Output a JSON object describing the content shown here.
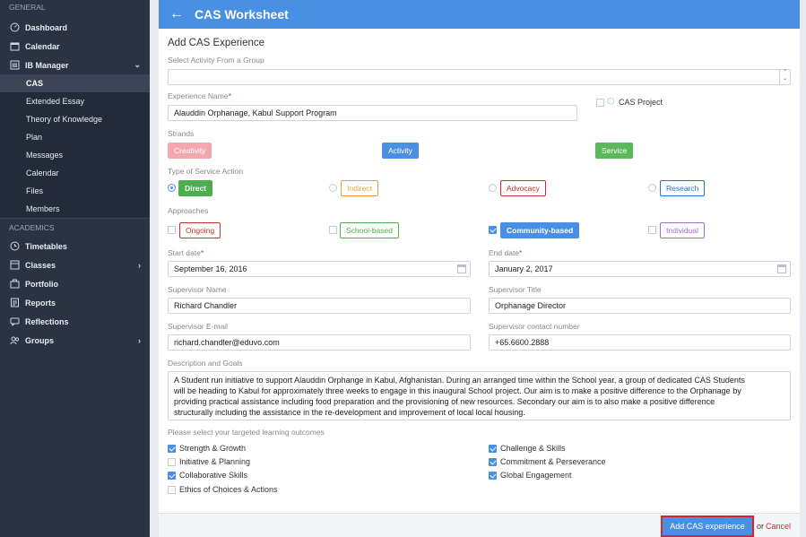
{
  "sidebar": {
    "general_label": "GENERAL",
    "academics_label": "ACADEMICS",
    "dashboard": "Dashboard",
    "calendar": "Calendar",
    "ib_manager": "IB Manager",
    "ib_items": [
      "CAS",
      "Extended Essay",
      "Theory of Knowledge",
      "Plan",
      "Messages",
      "Calendar",
      "Files",
      "Members"
    ],
    "timetables": "Timetables",
    "classes": "Classes",
    "portfolio": "Portfolio",
    "reports": "Reports",
    "reflections": "Reflections",
    "groups": "Groups"
  },
  "header": {
    "title": "CAS Worksheet"
  },
  "form": {
    "heading": "Add CAS Experience",
    "select_activity_label": "Select Activity From a Group",
    "select_activity_value": "",
    "experience_name_label": "Experience Name",
    "experience_name_value": "Alauddin Orphanage, Kabul Support Program",
    "cas_project_label": "CAS Project",
    "strands_label": "Strands",
    "strands": [
      "Creativity",
      "Activity",
      "Service"
    ],
    "service_type_label": "Type of Service Action",
    "service_types": [
      "Direct",
      "Indirect",
      "Advocacy",
      "Research"
    ],
    "approaches_label": "Approaches",
    "approaches": [
      "Ongoing",
      "School-based",
      "Community-based",
      "Individual"
    ],
    "start_date_label": "Start date",
    "start_date_value": "September 16, 2016",
    "end_date_label": "End date",
    "end_date_value": "January 2, 2017",
    "supervisor_name_label": "Supervisor Name",
    "supervisor_name_value": "Richard Chandler",
    "supervisor_title_label": "Supervisor Title",
    "supervisor_title_value": "Orphanage Director",
    "supervisor_email_label": "Supervisor E-mail",
    "supervisor_email_value": "richard.chandler@eduvo.com",
    "supervisor_contact_label": "Supervisor contact number",
    "supervisor_contact_value": "+65.6600.2888",
    "description_label": "Description and Goals",
    "description_lines": [
      "A Student run initiative to support Alauddin Orphange in Kabul, Afghanistan. During an arranged time within the School year, a group of dedicated CAS Students",
      "will be heading to Kabul for approximately three weeks to engage in this inaugural School project. Our aim is to make a positive difference to the Orphanage by",
      "providing practical assistance including food preparation and the provisioning of new resources. Secondary our aim is to also make a positive difference",
      "structurally including the assistance in the re-development and improvement of local local housing."
    ],
    "outcomes_label": "Please select your targeted learning outcomes",
    "outcomes_left": [
      "Strength & Growth",
      "Initiative & Planning",
      "Collaborative Skills",
      "Ethics of Choices & Actions"
    ],
    "outcomes_right": [
      "Challenge & Skills",
      "Commitment & Perseverance",
      "Global Engagement"
    ]
  },
  "footer": {
    "add_label": "Add CAS experience",
    "or_label": "or",
    "cancel_label": "Cancel"
  },
  "colors": {
    "accent": "#4a90e2",
    "sidebar": "#2a3342",
    "danger": "#d9252c"
  }
}
